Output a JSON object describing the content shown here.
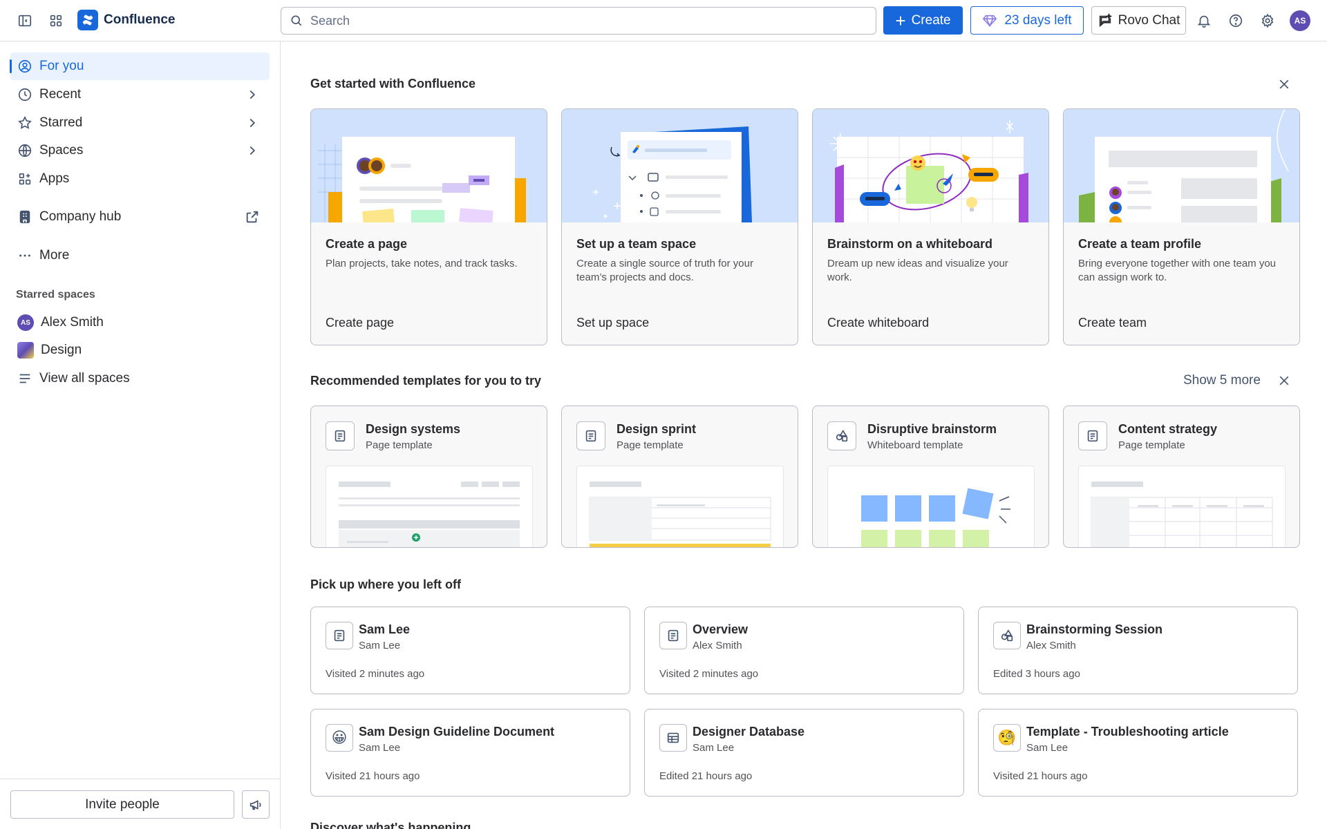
{
  "app": {
    "name": "Confluence"
  },
  "topbar": {
    "search_placeholder": "Search",
    "create_label": "Create",
    "trial_label": "23 days left",
    "rovo_label": "Rovo Chat",
    "avatar_initials": "AS"
  },
  "sidebar": {
    "items": [
      {
        "label": "For you"
      },
      {
        "label": "Recent"
      },
      {
        "label": "Starred"
      },
      {
        "label": "Spaces"
      },
      {
        "label": "Apps"
      },
      {
        "label": "Company hub"
      },
      {
        "label": "More"
      }
    ],
    "starred_section": "Starred spaces",
    "starred": [
      {
        "label": "Alex Smith",
        "initials": "AS"
      },
      {
        "label": "Design"
      },
      {
        "label": "View all spaces"
      }
    ],
    "invite_label": "Invite people"
  },
  "get_started": {
    "title": "Get started with Confluence",
    "cards": [
      {
        "title": "Create a page",
        "desc": "Plan projects, take notes, and track tasks.",
        "action": "Create page"
      },
      {
        "title": "Set up a team space",
        "desc": "Create a single source of truth for your team’s projects and docs.",
        "action": "Set up space"
      },
      {
        "title": "Brainstorm on a whiteboard",
        "desc": "Dream up new ideas and visualize your work.",
        "action": "Create whiteboard"
      },
      {
        "title": "Create a team profile",
        "desc": "Bring everyone together with one team you can assign work to.",
        "action": "Create team"
      }
    ]
  },
  "templates": {
    "title": "Recommended templates for you to try",
    "show_more": "Show 5 more",
    "cards": [
      {
        "title": "Design systems",
        "type": "Page template"
      },
      {
        "title": "Design sprint",
        "type": "Page template"
      },
      {
        "title": "Disruptive brainstorm",
        "type": "Whiteboard template"
      },
      {
        "title": "Content strategy",
        "type": "Page template"
      }
    ]
  },
  "recent": {
    "title": "Pick up where you left off",
    "cards": [
      {
        "title": "Sam Lee",
        "owner": "Sam Lee",
        "status": "Visited 2 minutes ago",
        "icon": "page-icon"
      },
      {
        "title": "Overview",
        "owner": "Alex Smith",
        "status": "Visited 2 minutes ago",
        "icon": "page-icon"
      },
      {
        "title": "Brainstorming Session",
        "owner": "Alex Smith",
        "status": "Edited 3 hours ago",
        "icon": "whiteboard-icon"
      },
      {
        "title": "Sam Design Guideline Document",
        "owner": "Sam Lee",
        "status": "Visited 21 hours ago",
        "icon": "😀"
      },
      {
        "title": "Designer Database",
        "owner": "Sam Lee",
        "status": "Edited 21 hours ago",
        "icon": "database-icon"
      },
      {
        "title": "Template - Troubleshooting article",
        "owner": "Sam Lee",
        "status": "Visited 21 hours ago",
        "icon": "🧐"
      }
    ]
  },
  "bottom_section_title": "Discover what's happening",
  "colors": {
    "accent": "#1868db",
    "selected_bg": "#e9f2fe",
    "avatar": "#5e4db2"
  }
}
